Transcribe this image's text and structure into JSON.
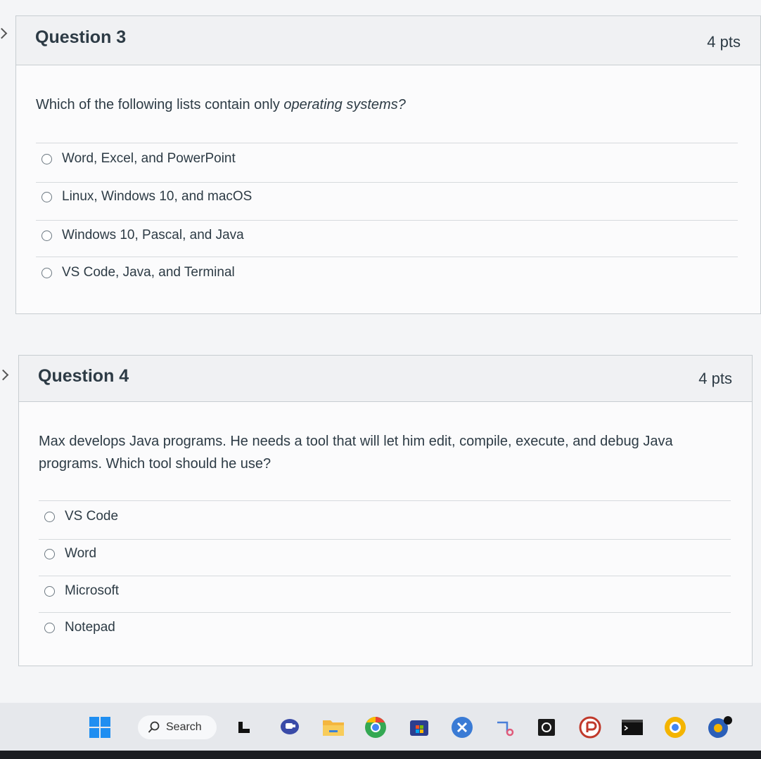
{
  "question3": {
    "title": "Question 3",
    "points": "4 pts",
    "prompt_before": "Which of the following lists contain only ",
    "prompt_emph": "operating systems?",
    "answers": [
      "Word, Excel, and PowerPoint",
      "Linux, Windows 10, and macOS",
      "Windows 10, Pascal, and Java",
      "VS Code, Java, and Terminal"
    ]
  },
  "question4": {
    "title": "Question 4",
    "points": "4 pts",
    "prompt_line1": "Max develops Java programs. He needs a tool that will let him edit, compile, execute, and debug Java",
    "prompt_line2": "programs. Which tool should he use?",
    "answers": [
      "VS Code",
      "Word",
      "Microsoft",
      "Notepad"
    ]
  },
  "taskbar": {
    "search_label": "Search",
    "icons": [
      "windows-start-icon",
      "search-icon",
      "file-explorer-icon",
      "chat-icon",
      "folder-icon",
      "chrome-icon",
      "store-icon",
      "app-icon",
      "snip-icon",
      "camera-icon",
      "app-red-icon",
      "terminal-icon",
      "chrome-alt-icon",
      "app-badge-icon"
    ]
  }
}
